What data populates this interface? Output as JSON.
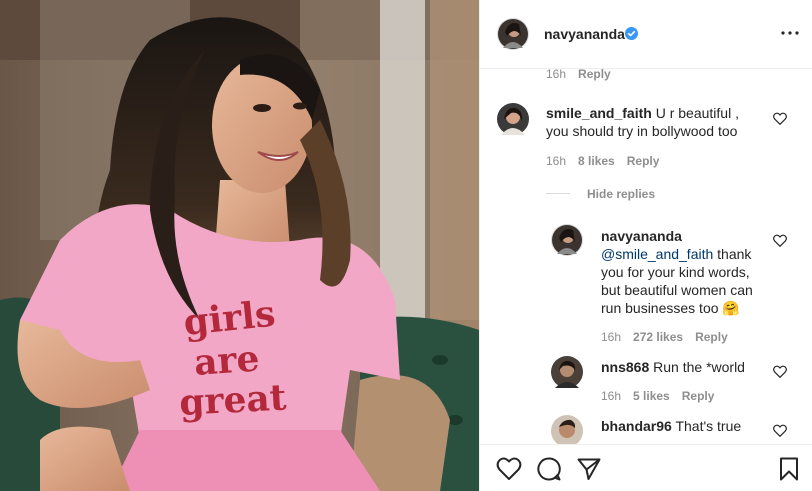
{
  "post": {
    "author": "navyananda",
    "verified": true,
    "photo": {
      "icon": "photo-of-smiling-woman-in-pink-tshirt",
      "shirt_text": [
        "girls",
        "are",
        "great"
      ]
    }
  },
  "previous_comment_meta": {
    "time": "16h",
    "reply": "Reply"
  },
  "comments": [
    {
      "username": "smile_and_faith",
      "text_line1": "U r beautiful ,",
      "text_line2": "you should try in bollywood too",
      "time": "16h",
      "likes": "8 likes",
      "reply": "Reply"
    }
  ],
  "hide_replies": "Hide replies",
  "replies": [
    {
      "username": "navyananda",
      "mention": "@smile_and_faith",
      "text_after_mention": "thank",
      "line2": "you for your kind words,",
      "line3": "but beautiful women can",
      "line4": "run businesses too",
      "emoji": "🤗",
      "time": "16h",
      "likes": "272 likes",
      "reply": "Reply"
    },
    {
      "username": "nns868",
      "text": "Run the *world",
      "time": "16h",
      "likes": "5 likes",
      "reply": "Reply"
    },
    {
      "username": "bhandar96",
      "text": "That's true"
    }
  ],
  "icons": {
    "like": "heart-outline-icon",
    "comment": "comment-bubble-icon",
    "share": "paper-plane-icon",
    "save": "bookmark-icon",
    "more": "more-dots-icon",
    "verified": "verified-badge-icon"
  },
  "colors": {
    "verified": "#3897f0",
    "text": "#262626",
    "secondary": "#8e8e8e",
    "mention": "#00376b",
    "divider": "#efefef"
  }
}
